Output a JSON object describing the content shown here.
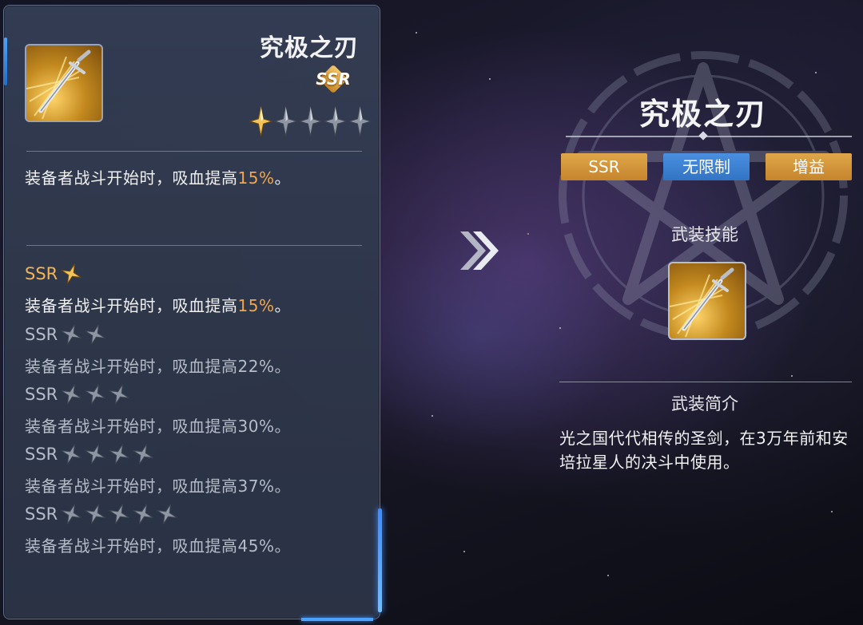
{
  "item": {
    "name": "究极之刃",
    "rarity": "SSR",
    "star_rating": {
      "filled": 1,
      "total": 5
    },
    "current_effect": {
      "prefix": "装备者战斗开始时，吸血提高",
      "value": "15%",
      "suffix": "。"
    }
  },
  "levels": [
    {
      "label": "SSR",
      "stars": 1,
      "prefix": "装备者战斗开始时，吸血提高",
      "value": "15%",
      "suffix": "。",
      "active": true
    },
    {
      "label": "SSR",
      "stars": 2,
      "prefix": "装备者战斗开始时，吸血提高",
      "value": "22%",
      "suffix": "。",
      "active": false
    },
    {
      "label": "SSR",
      "stars": 3,
      "prefix": "装备者战斗开始时，吸血提高",
      "value": "30%",
      "suffix": "。",
      "active": false
    },
    {
      "label": "SSR",
      "stars": 4,
      "prefix": "装备者战斗开始时，吸血提高",
      "value": "37%",
      "suffix": "。",
      "active": false
    },
    {
      "label": "SSR",
      "stars": 5,
      "prefix": "装备者战斗开始时，吸血提高",
      "value": "45%",
      "suffix": "。",
      "active": false
    }
  ],
  "detail": {
    "title": "究极之刃",
    "tags": [
      {
        "label": "SSR",
        "color": "#d79a3e"
      },
      {
        "label": "无限制",
        "color": "#3f82d4"
      },
      {
        "label": "增益",
        "color": "#d79a3e"
      }
    ],
    "skill_heading": "武装技能",
    "intro_heading": "武装简介",
    "intro_text": "光之国代代相传的圣剑，在3万年前和安培拉星人的决斗中使用。"
  },
  "icons": {
    "weapon": "sword-icon",
    "arrow": "double-chevron-right-icon",
    "star": "star-icon"
  },
  "colors": {
    "highlight": "#f0a64e",
    "gold_star": "#f3c45a",
    "grey_star": "#8e96a4"
  }
}
